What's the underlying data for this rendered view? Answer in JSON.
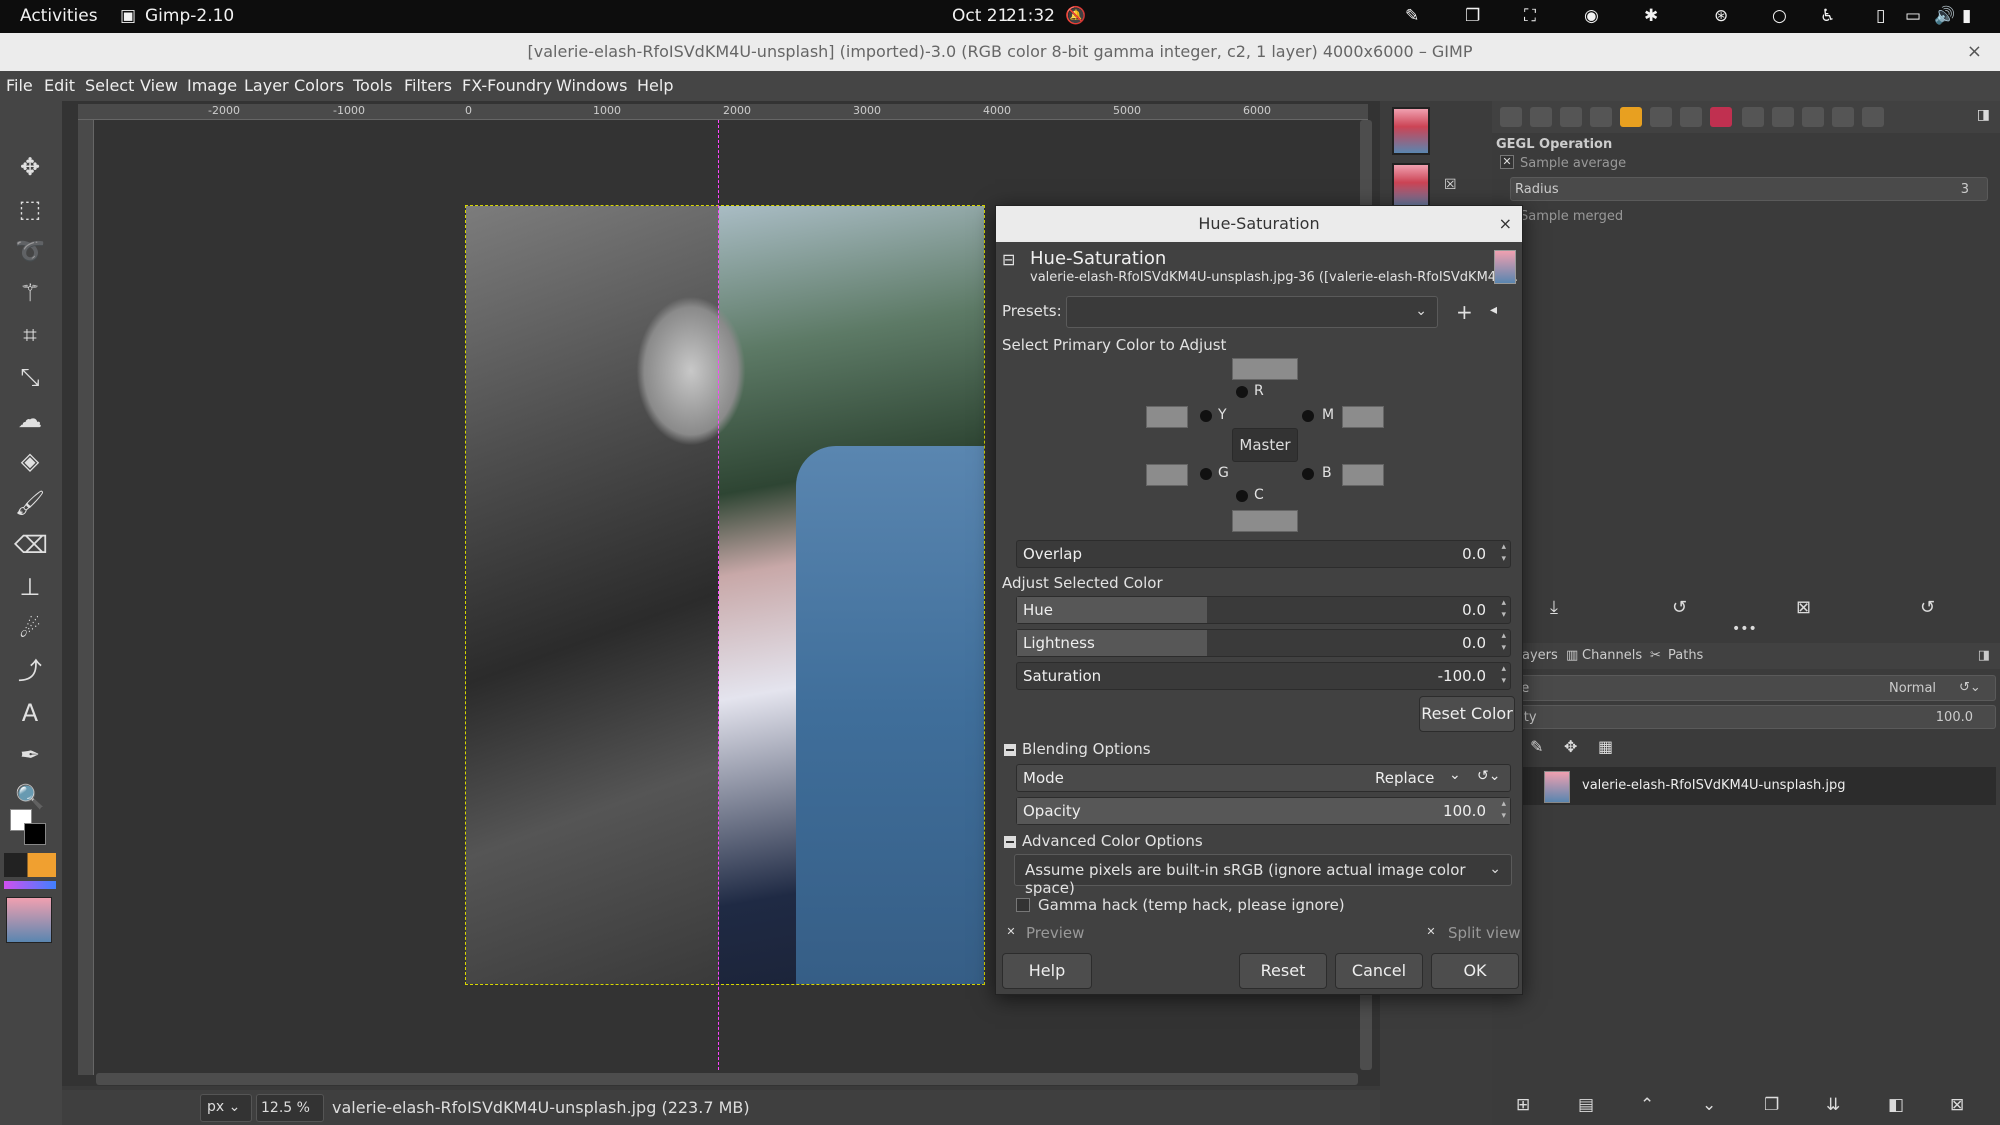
{
  "topbar": {
    "activities": "Activities",
    "app": "Gimp-2.10",
    "date": "Oct 21",
    "time": "21:32"
  },
  "window": {
    "title": "[valerie-elash-RfoISVdKM4U-unsplash] (imported)-3.0 (RGB color 8-bit gamma integer, c2, 1 layer) 4000x6000 – GIMP",
    "close": "×"
  },
  "menu": [
    "File",
    "Edit",
    "Select",
    "View",
    "Image",
    "Layer",
    "Colors",
    "Tools",
    "Filters",
    "FX-Foundry",
    "Windows",
    "Help"
  ],
  "ruler": {
    "ticks": [
      "-2000",
      "-1000",
      "0",
      "1000",
      "2000",
      "3000",
      "4000",
      "5000",
      "6000"
    ]
  },
  "status": {
    "unit": "px",
    "zoom": "12.5 %",
    "filename": "valerie-elash-RfoISVdKM4U-unsplash.jpg (223.7 MB)"
  },
  "tool_options": {
    "header": "GEGL Operation",
    "sample_average": "Sample average",
    "radius_label": "Radius",
    "radius_value": "3",
    "sample_merged": "Sample merged"
  },
  "layers": {
    "tabs": [
      "ayers",
      "Channels",
      "Paths"
    ],
    "mode_label": "de",
    "mode_value": "Normal",
    "opacity_label": "city",
    "opacity_value": "100.0",
    "layer_name": "valerie-elash-RfoISVdKM4U-unsplash.jpg"
  },
  "dialog": {
    "title": "Hue-Saturation",
    "close": "×",
    "header_title": "Hue-Saturation",
    "header_sub": "valerie-elash-RfoISVdKM4U-unsplash.jpg-36 ([valerie-elash-RfoISVdKM4U...",
    "presets_label": "Presets:",
    "select_primary": "Select Primary Color to Adjust",
    "colors": {
      "r": "R",
      "y": "Y",
      "m": "M",
      "master": "Master",
      "g": "G",
      "b": "B",
      "c": "C"
    },
    "overlap": {
      "label": "Overlap",
      "value": "0.0"
    },
    "adjust_selected": "Adjust Selected Color",
    "hue": {
      "label": "Hue",
      "value": "0.0"
    },
    "lightness": {
      "label": "Lightness",
      "value": "0.0"
    },
    "saturation": {
      "label": "Saturation",
      "value": "-100.0"
    },
    "reset_color": "Reset Color",
    "blending_options": "Blending Options",
    "mode": {
      "label": "Mode",
      "value": "Replace"
    },
    "opacity": {
      "label": "Opacity",
      "value": "100.0"
    },
    "advanced_color": "Advanced Color Options",
    "color_space": "Assume pixels are built-in sRGB (ignore actual image color space)",
    "gamma_hack": "Gamma hack (temp hack, please ignore)",
    "preview": "Preview",
    "split_view": "Split view",
    "buttons": {
      "help": "Help",
      "reset": "Reset",
      "cancel": "Cancel",
      "ok": "OK"
    }
  }
}
